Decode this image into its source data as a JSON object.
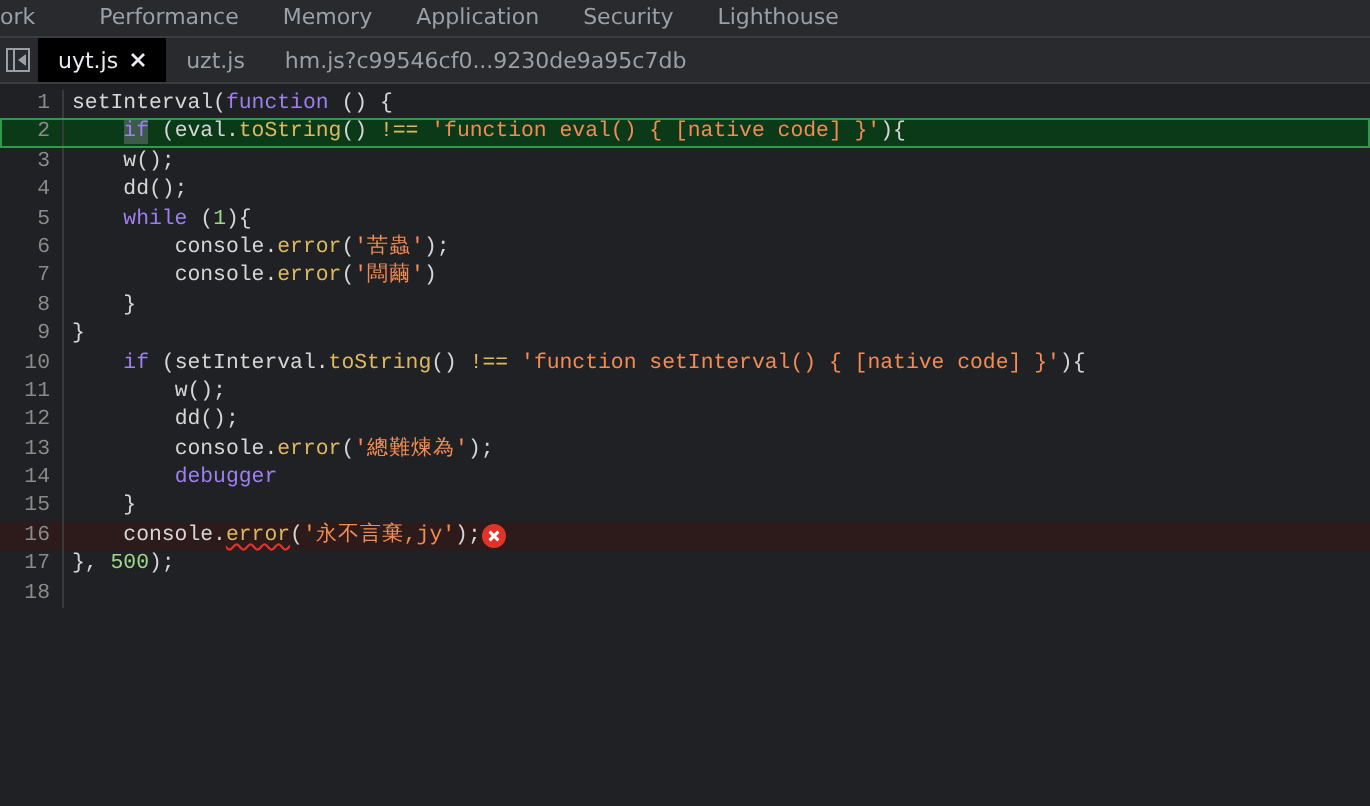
{
  "panel_tabs": [
    "ork",
    "Performance",
    "Memory",
    "Application",
    "Security",
    "Lighthouse"
  ],
  "file_tabs": [
    {
      "label": "uyt.js",
      "selected": true,
      "closable": true
    },
    {
      "label": "uzt.js",
      "selected": false,
      "closable": false
    },
    {
      "label": "hm.js?c99546cf0...9230de9a95c7db",
      "selected": false,
      "closable": false
    }
  ],
  "code_lines": [
    {
      "number": "1",
      "paused": false,
      "error": false,
      "tokens": [
        {
          "kind": "plain",
          "text": "setInterval("
        },
        {
          "kind": "keyword",
          "text": "function"
        },
        {
          "kind": "plain",
          "text": " () {"
        }
      ]
    },
    {
      "number": "2",
      "paused": true,
      "error": false,
      "tokens": [
        {
          "kind": "current",
          "text": "    if"
        },
        {
          "kind": "plain",
          "text": " (eval."
        },
        {
          "kind": "method",
          "text": "toString"
        },
        {
          "kind": "plain",
          "text": "() "
        },
        {
          "kind": "operator",
          "text": "!=="
        },
        {
          "kind": "string",
          "text": " 'function eval() { [native code] }'"
        },
        {
          "kind": "plain",
          "text": "){"
        }
      ]
    },
    {
      "number": "3",
      "paused": false,
      "error": false,
      "tokens": [
        {
          "kind": "plain",
          "text": "    w();"
        }
      ]
    },
    {
      "number": "4",
      "paused": false,
      "error": false,
      "tokens": [
        {
          "kind": "plain",
          "text": "    dd();"
        }
      ]
    },
    {
      "number": "5",
      "paused": false,
      "error": false,
      "tokens": [
        {
          "kind": "keyword",
          "text": "    while"
        },
        {
          "kind": "plain",
          "text": " ("
        },
        {
          "kind": "number",
          "text": "1"
        },
        {
          "kind": "plain",
          "text": "){"
        }
      ]
    },
    {
      "number": "6",
      "paused": false,
      "error": false,
      "tokens": [
        {
          "kind": "plain",
          "text": "        console."
        },
        {
          "kind": "method",
          "text": "error"
        },
        {
          "kind": "plain",
          "text": "("
        },
        {
          "kind": "string",
          "text": "'苦蟲'"
        },
        {
          "kind": "plain",
          "text": ");"
        }
      ]
    },
    {
      "number": "7",
      "paused": false,
      "error": false,
      "tokens": [
        {
          "kind": "plain",
          "text": "        console."
        },
        {
          "kind": "method",
          "text": "error"
        },
        {
          "kind": "plain",
          "text": "("
        },
        {
          "kind": "string",
          "text": "'闆繭'"
        },
        {
          "kind": "plain",
          "text": ")"
        }
      ]
    },
    {
      "number": "8",
      "paused": false,
      "error": false,
      "tokens": [
        {
          "kind": "plain",
          "text": "    }"
        }
      ]
    },
    {
      "number": "9",
      "paused": false,
      "error": false,
      "tokens": [
        {
          "kind": "plain",
          "text": "}"
        }
      ]
    },
    {
      "number": "10",
      "paused": false,
      "error": false,
      "tokens": [
        {
          "kind": "keyword",
          "text": "    if"
        },
        {
          "kind": "plain",
          "text": " (setInterval."
        },
        {
          "kind": "method",
          "text": "toString"
        },
        {
          "kind": "plain",
          "text": "() "
        },
        {
          "kind": "operator",
          "text": "!=="
        },
        {
          "kind": "string",
          "text": " 'function setInterval() { [native code] }'"
        },
        {
          "kind": "plain",
          "text": "){"
        }
      ]
    },
    {
      "number": "11",
      "paused": false,
      "error": false,
      "tokens": [
        {
          "kind": "plain",
          "text": "        w();"
        }
      ]
    },
    {
      "number": "12",
      "paused": false,
      "error": false,
      "tokens": [
        {
          "kind": "plain",
          "text": "        dd();"
        }
      ]
    },
    {
      "number": "13",
      "paused": false,
      "error": false,
      "tokens": [
        {
          "kind": "plain",
          "text": "        console."
        },
        {
          "kind": "method",
          "text": "error"
        },
        {
          "kind": "plain",
          "text": "("
        },
        {
          "kind": "string",
          "text": "'總難煉為'"
        },
        {
          "kind": "plain",
          "text": ");"
        }
      ]
    },
    {
      "number": "14",
      "paused": false,
      "error": false,
      "tokens": [
        {
          "kind": "keyword",
          "text": "        debugger"
        }
      ]
    },
    {
      "number": "15",
      "paused": false,
      "error": false,
      "tokens": [
        {
          "kind": "plain",
          "text": "    }"
        }
      ]
    },
    {
      "number": "16",
      "paused": false,
      "error": true,
      "tokens": [
        {
          "kind": "plain",
          "text": "    console."
        },
        {
          "kind": "method-error",
          "text": "error"
        },
        {
          "kind": "plain",
          "text": "("
        },
        {
          "kind": "string",
          "text": "'永不言棄,jy'"
        },
        {
          "kind": "plain",
          "text": ");"
        }
      ]
    },
    {
      "number": "17",
      "paused": false,
      "error": false,
      "tokens": [
        {
          "kind": "plain",
          "text": "}, "
        },
        {
          "kind": "number",
          "text": "500"
        },
        {
          "kind": "plain",
          "text": ");"
        }
      ]
    },
    {
      "number": "18",
      "paused": false,
      "error": false
    }
  ]
}
